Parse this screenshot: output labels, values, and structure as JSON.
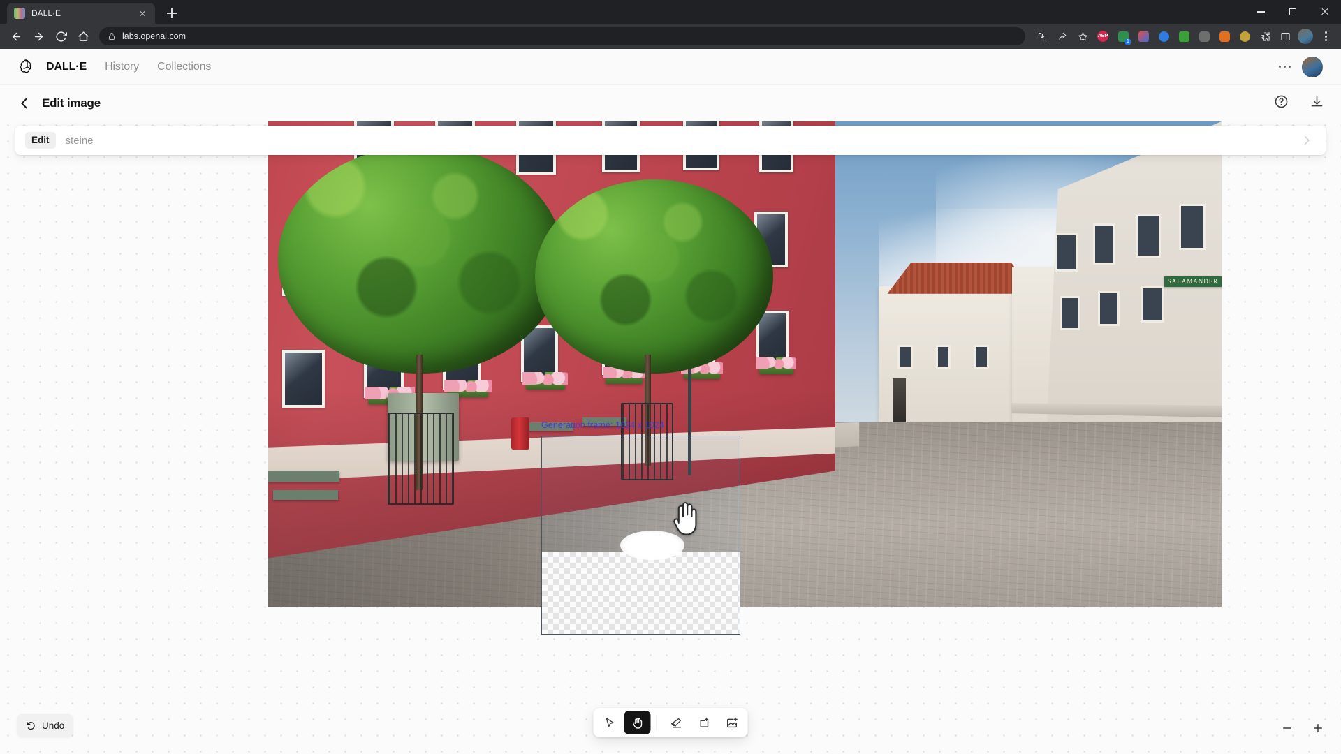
{
  "browser": {
    "tab": {
      "title": "DALL·E",
      "favicon_icon": "dalle-favicon",
      "close_icon": "close-icon"
    },
    "new_tab_icon": "plus-icon",
    "window_controls": {
      "minimize_icon": "minimize-icon",
      "maximize_icon": "maximize-icon",
      "close_icon": "close-icon"
    },
    "nav": {
      "back_icon": "arrow-left-icon",
      "forward_icon": "arrow-right-icon",
      "reload_icon": "reload-icon",
      "home_icon": "home-icon"
    },
    "omnibox": {
      "lock_icon": "lock-icon",
      "url": "labs.openai.com"
    },
    "toolbar_icons": [
      {
        "name": "install-app-icon",
        "label": ""
      },
      {
        "name": "share-icon",
        "label": ""
      },
      {
        "name": "bookmark-star-icon",
        "label": ""
      },
      {
        "name": "adblock-plus-extension-icon",
        "label": "ABP"
      },
      {
        "name": "grammar-extension-icon",
        "label": ""
      },
      {
        "name": "color-picker-extension-icon",
        "label": "1"
      },
      {
        "name": "video-extension-icon",
        "label": ""
      },
      {
        "name": "lastpass-extension-icon",
        "label": ""
      },
      {
        "name": "screenshot-extension-icon",
        "label": ""
      },
      {
        "name": "translate-extension-icon",
        "label": ""
      },
      {
        "name": "shield-extension-icon",
        "label": ""
      },
      {
        "name": "puzzle-extensions-icon",
        "label": ""
      },
      {
        "name": "sidepanel-icon",
        "label": ""
      },
      {
        "name": "chrome-profile-avatar",
        "label": ""
      },
      {
        "name": "chrome-menu-icon",
        "label": ""
      }
    ]
  },
  "app": {
    "logo_icon": "openai-logo",
    "nav": [
      {
        "label": "DALL·E",
        "active": true
      },
      {
        "label": "History",
        "active": false
      },
      {
        "label": "Collections",
        "active": false
      }
    ],
    "header_more_icon": "more-horizontal-icon",
    "avatar_icon": "user-avatar"
  },
  "editbar": {
    "back_icon": "chevron-left-icon",
    "title": "Edit image",
    "help_icon": "help-circle-icon",
    "download_icon": "download-icon"
  },
  "prompt": {
    "chip_label": "Edit",
    "value": "",
    "placeholder": "steine",
    "send_icon": "arrow-right-icon"
  },
  "canvas": {
    "generation_frame_label": "Generation frame: 1024 x 1024",
    "generation_frame_color": "#4b3bd4",
    "cursor_icon": "hand-cursor",
    "image_description": "Red facade building on a cobblestone town square with two green trees, benches, a red trash bin, street lamp and shops along the right side under a partly cloudy sky"
  },
  "tools": [
    {
      "name": "select-tool",
      "icon": "cursor-arrow-icon",
      "active": false
    },
    {
      "name": "hand-tool",
      "icon": "hand-icon",
      "active": true
    },
    {
      "name": "eraser-tool",
      "icon": "eraser-icon",
      "active": false
    },
    {
      "name": "add-generation-frame-tool",
      "icon": "frame-plus-icon",
      "active": false
    },
    {
      "name": "upload-image-tool",
      "icon": "image-plus-icon",
      "active": false
    }
  ],
  "footer": {
    "undo_label": "Undo",
    "undo_icon": "undo-arrow-icon",
    "zoom_out_icon": "minus-icon",
    "zoom_in_icon": "plus-icon"
  }
}
